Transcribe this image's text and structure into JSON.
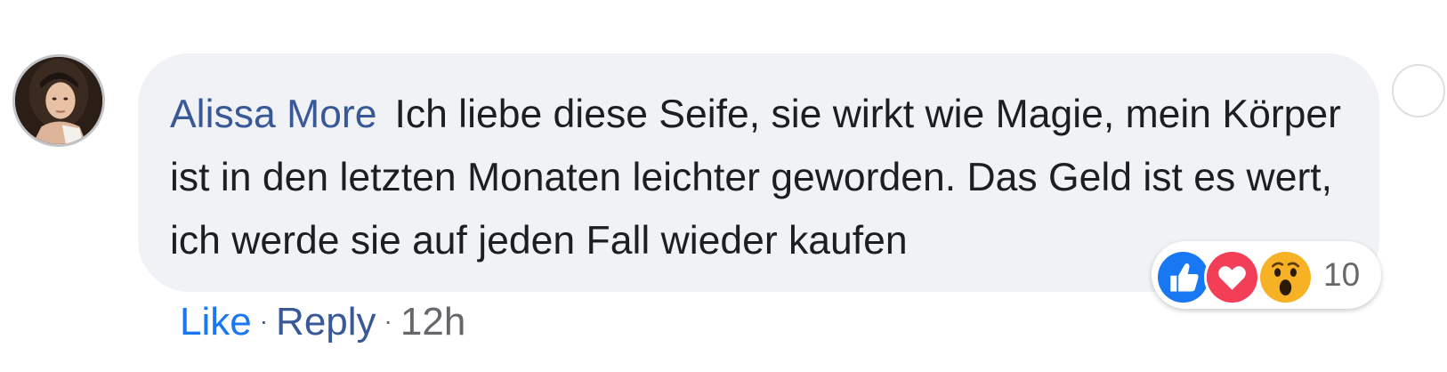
{
  "comment": {
    "author": "Alissa More",
    "text": "Ich liebe diese Seife, sie wirkt wie Magie, mein Körper ist in den letzten Monaten leichter geworden. Das Geld ist es wert, ich werde sie auf jeden Fall wieder kaufen",
    "avatar_icon": "profile-photo"
  },
  "reactions": {
    "icons": [
      "like-reaction-icon",
      "love-reaction-icon",
      "wow-reaction-icon"
    ],
    "count": "10",
    "colors": {
      "like": "#1877f2",
      "love": "#f33e58",
      "wow": "#f7b125"
    }
  },
  "actions": {
    "like_label": "Like",
    "separator": "·",
    "reply_label": "Reply",
    "timestamp": "12h"
  },
  "colors": {
    "bubble_bg": "#f0f2f5",
    "author_name": "#385898",
    "like_link": "#1877f2",
    "meta_text": "#65676b"
  }
}
